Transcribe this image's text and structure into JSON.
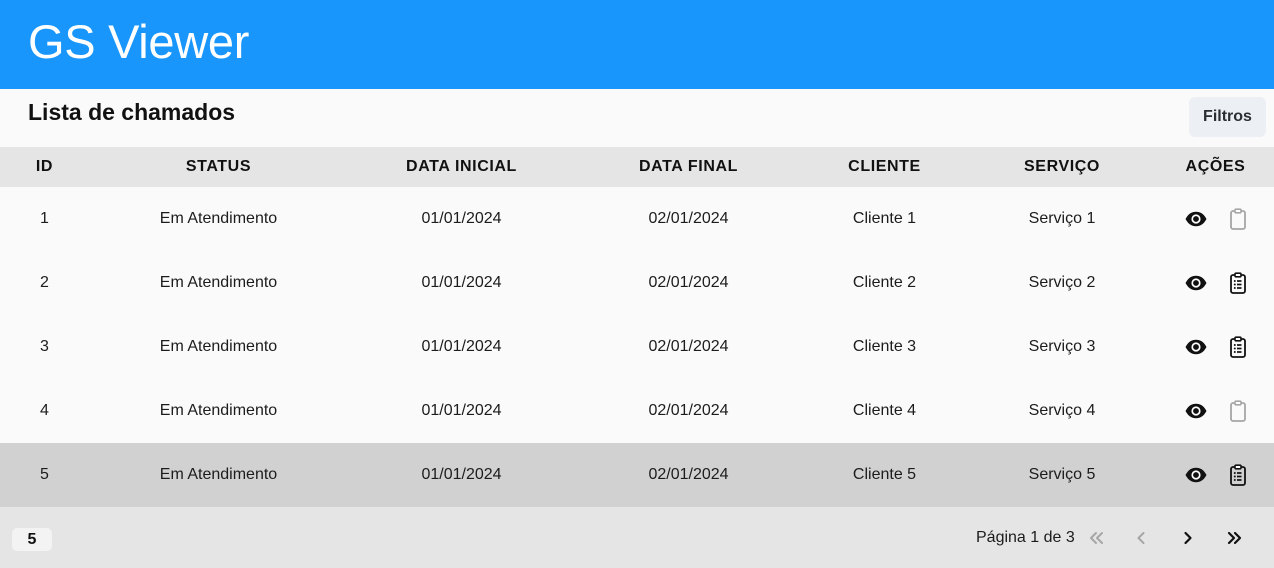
{
  "app": {
    "title": "GS Viewer"
  },
  "header": {
    "title": "Lista de chamados",
    "filter_label": "Filtros"
  },
  "table": {
    "columns": [
      "ID",
      "STATUS",
      "DATA INICIAL",
      "DATA FINAL",
      "CLIENTE",
      "SERVIÇO",
      "AÇÕES"
    ],
    "rows": [
      {
        "id": "1",
        "status": "Em Atendimento",
        "data_inicial": "01/01/2024",
        "data_final": "02/01/2024",
        "cliente": "Cliente 1",
        "servico": "Serviço 1",
        "report_enabled": false,
        "selected": false
      },
      {
        "id": "2",
        "status": "Em Atendimento",
        "data_inicial": "01/01/2024",
        "data_final": "02/01/2024",
        "cliente": "Cliente 2",
        "servico": "Serviço 2",
        "report_enabled": true,
        "selected": false
      },
      {
        "id": "3",
        "status": "Em Atendimento",
        "data_inicial": "01/01/2024",
        "data_final": "02/01/2024",
        "cliente": "Cliente 3",
        "servico": "Serviço 3",
        "report_enabled": true,
        "selected": false
      },
      {
        "id": "4",
        "status": "Em Atendimento",
        "data_inicial": "01/01/2024",
        "data_final": "02/01/2024",
        "cliente": "Cliente 4",
        "servico": "Serviço 4",
        "report_enabled": false,
        "selected": false
      },
      {
        "id": "5",
        "status": "Em Atendimento",
        "data_inicial": "01/01/2024",
        "data_final": "02/01/2024",
        "cliente": "Cliente 5",
        "servico": "Serviço 5",
        "report_enabled": true,
        "selected": true
      }
    ],
    "action_icons": [
      "eye-icon",
      "clipboard-list-icon"
    ]
  },
  "pagination": {
    "page_size": "5",
    "page_label": "Página 1 de 3",
    "first_enabled": false,
    "prev_enabled": false,
    "next_enabled": true,
    "last_enabled": true
  },
  "colors": {
    "appbar": "#1896fc",
    "header_row": "#e5e5e5",
    "selected_row": "#d1d1d1",
    "icon_enabled": "#111111",
    "icon_disabled": "#a6a6a6"
  }
}
